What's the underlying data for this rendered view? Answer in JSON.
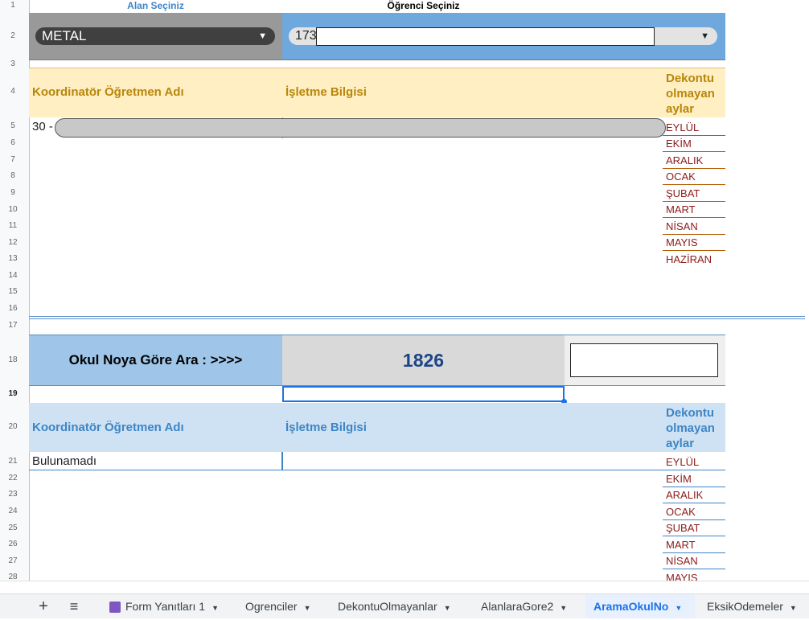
{
  "rows": [
    "1",
    "2",
    "3",
    "4",
    "5",
    "6",
    "7",
    "8",
    "9",
    "10",
    "11",
    "12",
    "13",
    "14",
    "15",
    "16",
    "17",
    "18",
    "19",
    "20",
    "21",
    "22",
    "23",
    "24",
    "25",
    "26",
    "27",
    "28"
  ],
  "top": {
    "alan_label": "Alan Seçiniz",
    "ogrenci_label": "Öğrenci Seçiniz",
    "alan_value": "METAL",
    "ogrenci_value": "173",
    "coord_header": "Koordinatör Öğretmen Adı",
    "isletme_header": "İşletme Bilgisi",
    "dekont_header": "Dekontu olmayan aylar",
    "coord_value": "30 -",
    "months": [
      "EYLÜL",
      "EKİM",
      "ARALIK",
      "OCAK",
      "ŞUBAT",
      "MART",
      "NİSAN",
      "MAYIS",
      "HAZİRAN"
    ]
  },
  "search": {
    "label": "Okul Noya Göre Ara : >>>>",
    "value": "1826",
    "coord_header": "Koordinatör Öğretmen Adı",
    "isletme_header": "İşletme Bilgisi",
    "dekont_header": "Dekontu olmayan aylar",
    "result": "Bulunamadı",
    "months": [
      "EYLÜL",
      "EKİM",
      "ARALIK",
      "OCAK",
      "ŞUBAT",
      "MART",
      "NİSAN",
      "MAYIS"
    ]
  },
  "tabs": {
    "add": "+",
    "all": "≡",
    "items": [
      {
        "label": "Form Yanıtları 1"
      },
      {
        "label": "Ogrenciler"
      },
      {
        "label": "DekontuOlmayanlar"
      },
      {
        "label": "AlanlaraGore2"
      },
      {
        "label": "AramaOkulNo"
      },
      {
        "label": "EksikOdemeler"
      }
    ]
  },
  "colors": {
    "header_gold": "#b8860b",
    "header_blue": "#3d85c6",
    "month_red": "#8b1a1a",
    "selected_blue": "#1a73e8"
  }
}
